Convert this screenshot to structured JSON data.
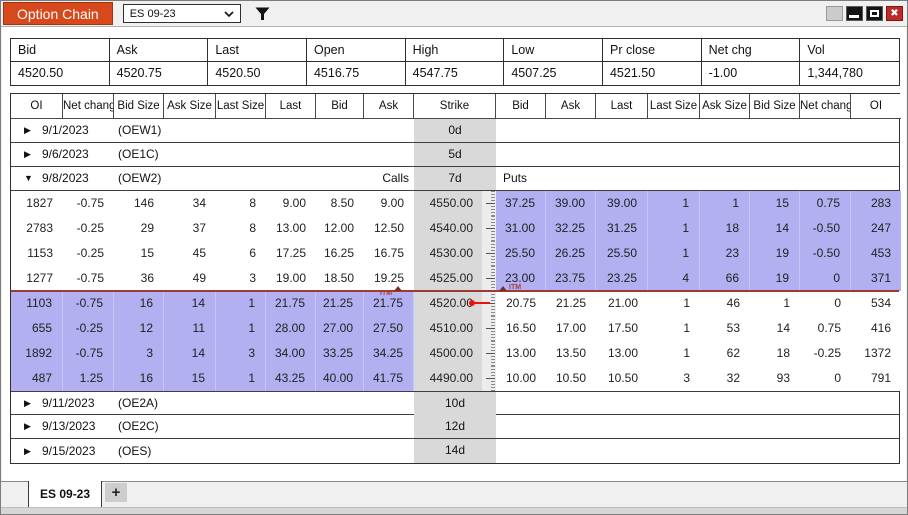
{
  "titlebar": {
    "app_tab": "Option Chain",
    "instrument_selector": {
      "value": "ES 09-23"
    },
    "icons": {
      "filter": "funnel",
      "chevron": "chevron-down",
      "close": "✖",
      "collapsed_arrow": "▶",
      "expanded_arrow": "▼"
    }
  },
  "summary": {
    "headers": [
      "Bid",
      "Ask",
      "Last",
      "Open",
      "High",
      "Low",
      "Pr close",
      "Net chg",
      "Vol"
    ],
    "values": [
      "4520.50",
      "4520.75",
      "4520.50",
      "4516.75",
      "4547.75",
      "4507.25",
      "4521.50",
      "-1.00",
      "1,344,780"
    ]
  },
  "chain": {
    "headers": [
      "OI",
      "Net chang",
      "Bid Size",
      "Ask Size",
      "Last Size",
      "Last",
      "Bid",
      "Ask",
      "Strike",
      "Bid",
      "Ask",
      "Last",
      "Last Size",
      "Ask Size",
      "Bid Size",
      "Net chang",
      "OI"
    ],
    "itm_label": "ITM",
    "price_line_before_strike": "4520.00",
    "groups": [
      {
        "date": "9/1/2023",
        "code": "(OEW1)",
        "days": "0d",
        "expanded": false
      },
      {
        "date": "9/6/2023",
        "code": "(OE1C)",
        "days": "5d",
        "expanded": false
      },
      {
        "date": "9/8/2023",
        "code": "(OEW2)",
        "days": "7d",
        "expanded": true,
        "calls_label": "Calls",
        "puts_label": "Puts",
        "rows": [
          {
            "strike": "4550.00",
            "call": {
              "oi": "1827",
              "net_chg": "-0.75",
              "bid_size": "146",
              "ask_size": "34",
              "last_size": "8",
              "last": "9.00",
              "bid": "8.50",
              "ask": "9.00",
              "itm": false
            },
            "put": {
              "bid": "37.25",
              "ask": "39.00",
              "last": "39.00",
              "last_size": "1",
              "ask_size": "1",
              "bid_size": "15",
              "net_chg": "0.75",
              "oi": "283",
              "itm": true
            }
          },
          {
            "strike": "4540.00",
            "call": {
              "oi": "2783",
              "net_chg": "-0.25",
              "bid_size": "29",
              "ask_size": "37",
              "last_size": "8",
              "last": "13.00",
              "bid": "12.00",
              "ask": "12.50",
              "itm": false
            },
            "put": {
              "bid": "31.00",
              "ask": "32.25",
              "last": "31.25",
              "last_size": "1",
              "ask_size": "18",
              "bid_size": "14",
              "net_chg": "-0.50",
              "oi": "247",
              "itm": true
            }
          },
          {
            "strike": "4530.00",
            "call": {
              "oi": "1153",
              "net_chg": "-0.25",
              "bid_size": "15",
              "ask_size": "45",
              "last_size": "6",
              "last": "17.25",
              "bid": "16.25",
              "ask": "16.75",
              "itm": false
            },
            "put": {
              "bid": "25.50",
              "ask": "26.25",
              "last": "25.50",
              "last_size": "1",
              "ask_size": "23",
              "bid_size": "19",
              "net_chg": "-0.50",
              "oi": "453",
              "itm": true
            }
          },
          {
            "strike": "4525.00",
            "call": {
              "oi": "1277",
              "net_chg": "-0.75",
              "bid_size": "36",
              "ask_size": "49",
              "last_size": "3",
              "last": "19.00",
              "bid": "18.50",
              "ask": "19.25",
              "itm": false
            },
            "put": {
              "bid": "23.00",
              "ask": "23.75",
              "last": "23.25",
              "last_size": "4",
              "ask_size": "66",
              "bid_size": "19",
              "net_chg": "0",
              "oi": "371",
              "itm": true
            }
          },
          {
            "strike": "4520.00",
            "price_marker": true,
            "call": {
              "oi": "1103",
              "net_chg": "-0.75",
              "bid_size": "16",
              "ask_size": "14",
              "last_size": "1",
              "last": "21.75",
              "bid": "21.25",
              "ask": "21.75",
              "itm": true
            },
            "put": {
              "bid": "20.75",
              "ask": "21.25",
              "last": "21.00",
              "last_size": "1",
              "ask_size": "46",
              "bid_size": "1",
              "net_chg": "0",
              "oi": "534",
              "itm": false
            }
          },
          {
            "strike": "4510.00",
            "call": {
              "oi": "655",
              "net_chg": "-0.25",
              "bid_size": "12",
              "ask_size": "11",
              "last_size": "1",
              "last": "28.00",
              "bid": "27.00",
              "ask": "27.50",
              "itm": true
            },
            "put": {
              "bid": "16.50",
              "ask": "17.00",
              "last": "17.50",
              "last_size": "1",
              "ask_size": "53",
              "bid_size": "14",
              "net_chg": "0.75",
              "oi": "416",
              "itm": false
            }
          },
          {
            "strike": "4500.00",
            "call": {
              "oi": "1892",
              "net_chg": "-0.75",
              "bid_size": "3",
              "ask_size": "14",
              "last_size": "3",
              "last": "34.00",
              "bid": "33.25",
              "ask": "34.25",
              "itm": true
            },
            "put": {
              "bid": "13.00",
              "ask": "13.50",
              "last": "13.00",
              "last_size": "1",
              "ask_size": "62",
              "bid_size": "18",
              "net_chg": "-0.25",
              "oi": "1372",
              "itm": false
            }
          },
          {
            "strike": "4490.00",
            "call": {
              "oi": "487",
              "net_chg": "1.25",
              "bid_size": "16",
              "ask_size": "15",
              "last_size": "1",
              "last": "43.25",
              "bid": "40.00",
              "ask": "41.75",
              "itm": true
            },
            "put": {
              "bid": "10.00",
              "ask": "10.50",
              "last": "10.50",
              "last_size": "3",
              "ask_size": "32",
              "bid_size": "93",
              "net_chg": "0",
              "oi": "791",
              "itm": false
            }
          }
        ]
      },
      {
        "date": "9/11/2023",
        "code": "(OE2A)",
        "days": "10d",
        "expanded": false
      },
      {
        "date": "9/13/2023",
        "code": "(OE2C)",
        "days": "12d",
        "expanded": false
      },
      {
        "date": "9/15/2023",
        "code": "(OES)",
        "days": "14d",
        "expanded": false
      }
    ]
  },
  "footer": {
    "active_tab": "ES 09-23",
    "add_tab": "+"
  },
  "colors": {
    "accent": "#d7491c",
    "itm_highlight": "#b2b0f0",
    "strike_column": "#d9d9d9",
    "price_line": "#9e3a36",
    "price_marker": "#e8140c"
  }
}
